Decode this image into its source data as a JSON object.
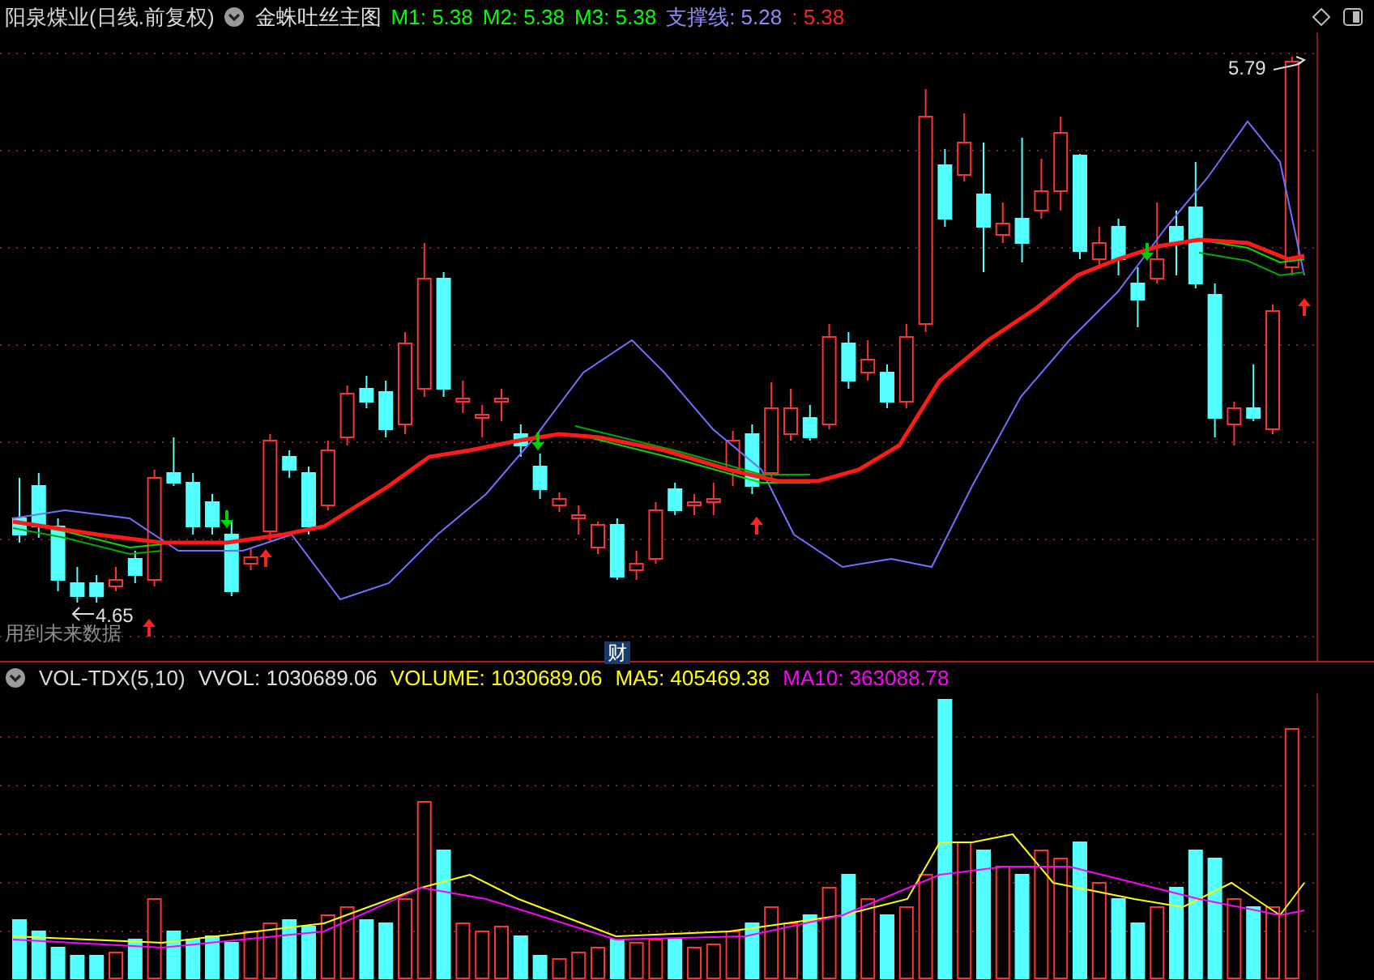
{
  "main_header": {
    "title": "阳泉煤业(日线.前复权)",
    "indicator": "金蛛吐丝主图",
    "values": [
      {
        "text": "M1: 5.38",
        "color": "#00ff00"
      },
      {
        "text": "M2: 5.38",
        "color": "#00ff00"
      },
      {
        "text": "M3: 5.38",
        "color": "#00ff00"
      },
      {
        "text": "支撑线: 5.28",
        "color": "#8c8cff"
      },
      {
        "text": ": 5.38",
        "color": "#ff2020"
      }
    ]
  },
  "chart_labels": {
    "high": "5.79",
    "low": "4.65",
    "warning": "用到未来数据",
    "badge": "财"
  },
  "volume_header": {
    "indicator": "VOL-TDX(5,10)",
    "values": [
      {
        "text": "VVOL: 1030689.06",
        "color": "#e0e0e0"
      },
      {
        "text": "VOLUME: 1030689.06",
        "color": "#ffff00"
      },
      {
        "text": "MA5: 405469.38",
        "color": "#ffff00"
      },
      {
        "text": "MA10: 363088.78",
        "color": "#ff00ff"
      }
    ]
  }
}
